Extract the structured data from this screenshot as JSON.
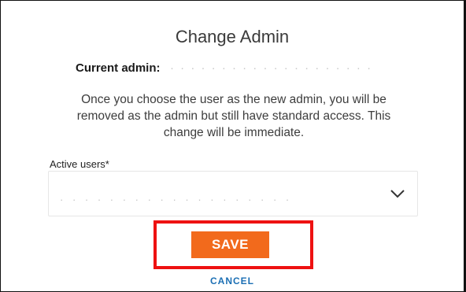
{
  "dialog": {
    "title": "Change Admin",
    "current_admin_label": "Current admin:",
    "current_admin_value": "· · · · · · · · · · · · · · · · · · · ·",
    "message": "Once you choose the user as the new admin, you will be removed as the admin but still have standard access. This change will be immediate."
  },
  "form": {
    "active_users_label": "Active users*",
    "selected_value": "· · · · · · · · · · · · · · · · · · ·",
    "chevron_icon": "chevron-down-icon"
  },
  "actions": {
    "save_label": "SAVE",
    "cancel_label": "CANCEL"
  },
  "colors": {
    "save_bg": "#f26a1c",
    "cancel_text": "#1b6fb4",
    "highlight_border": "#ee1111"
  }
}
